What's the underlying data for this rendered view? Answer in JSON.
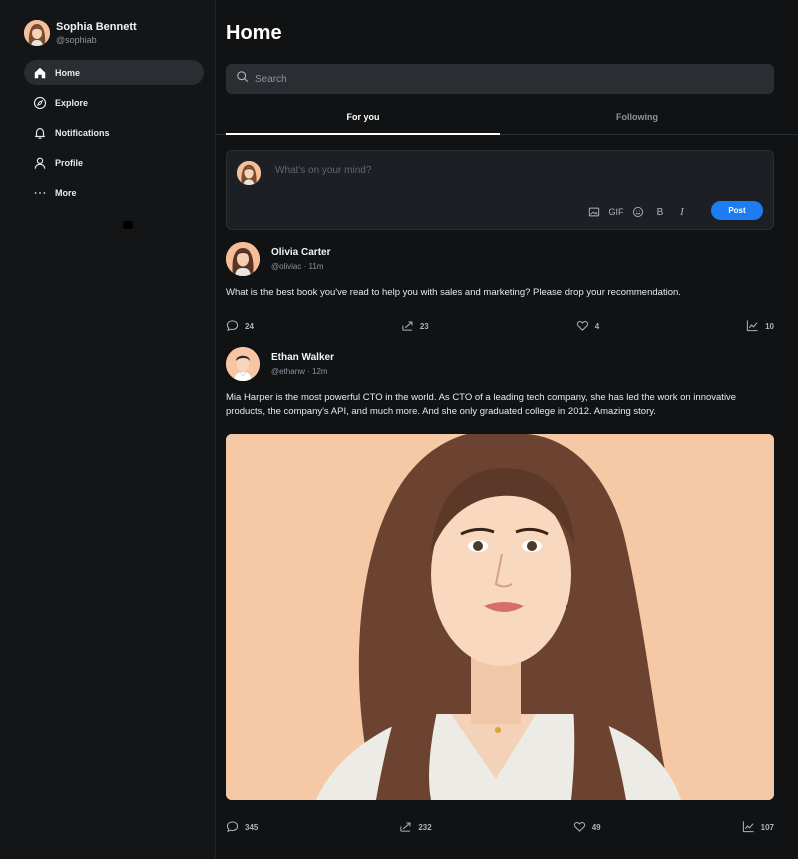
{
  "sidebar": {
    "user": {
      "name": "Sophia Bennett",
      "handle": "@sophiab"
    },
    "items": [
      {
        "label": "Home",
        "icon": "home-icon"
      },
      {
        "label": "Explore",
        "icon": "compass-icon"
      },
      {
        "label": "Notifications",
        "icon": "bell-icon"
      },
      {
        "label": "Profile",
        "icon": "user-icon"
      },
      {
        "label": "More",
        "icon": "more-icon"
      }
    ]
  },
  "main": {
    "title": "Home",
    "search": {
      "placeholder": "Search"
    },
    "tabs": [
      {
        "label": "For you"
      },
      {
        "label": "Following"
      }
    ],
    "composer": {
      "placeholder": "What's on your mind?",
      "gif_label": "GIF",
      "bold_label": "B",
      "italic_label": "I",
      "post_label": "Post"
    },
    "posts": [
      {
        "name": "Olivia Carter",
        "handle_time": "@oliviac · 11m",
        "text": "What is the best book you've read to help you with sales and marketing? Please drop your recommendation.",
        "comments": "24",
        "shares": "23",
        "likes": "4",
        "views": "10"
      },
      {
        "name": "Ethan Walker",
        "handle_time": "@ethanw · 12m",
        "text": "Mia Harper is the most powerful CTO in the world. As CTO of a leading tech company, she has led the work on innovative products, the company's API, and much more. And she only graduated college in 2012. Amazing story.",
        "comments": "345",
        "shares": "232",
        "likes": "49",
        "views": "107"
      }
    ]
  },
  "colors": {
    "background": "#101214",
    "accent": "#1d7cf2",
    "surface": "#2a2e33"
  }
}
